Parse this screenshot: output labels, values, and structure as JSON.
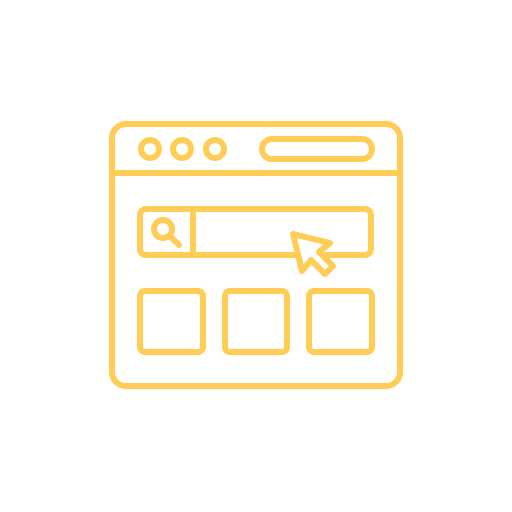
{
  "icon": {
    "name": "browser-search-icon",
    "stroke_color": "#FFCC55",
    "elements": {
      "window": "browser-window-frame",
      "dots": [
        "window-control-dot-1",
        "window-control-dot-2",
        "window-control-dot-3"
      ],
      "address_bar": "address-bar",
      "search_icon": "search-icon",
      "search_field": "search-field",
      "cursor": "cursor-arrow-icon",
      "tiles": [
        "content-tile-1",
        "content-tile-2",
        "content-tile-3"
      ]
    }
  }
}
